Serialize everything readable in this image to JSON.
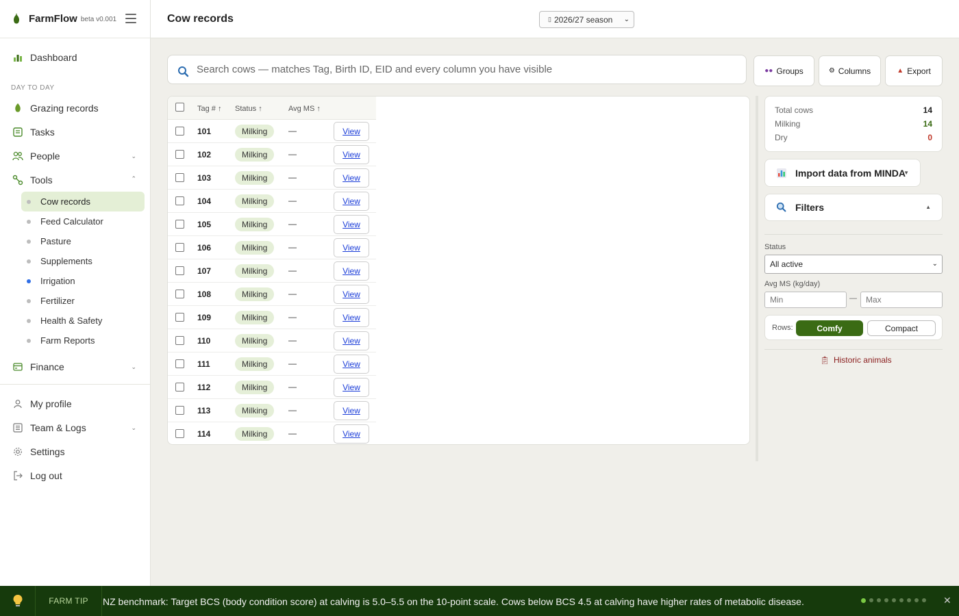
{
  "app": {
    "name": "FarmFlow",
    "version": "beta v0.001"
  },
  "sidebar": {
    "dashboard": "Dashboard",
    "section_day_to_day": "DAY TO DAY",
    "grazing": "Grazing records",
    "tasks": "Tasks",
    "people": "People",
    "tools": "Tools",
    "tools_items": [
      "Cow records",
      "Feed Calculator",
      "Pasture",
      "Supplements",
      "Irrigation",
      "Fertilizer",
      "Health & Safety",
      "Farm Reports"
    ],
    "finance": "Finance",
    "my_profile": "My profile",
    "team_logs": "Team & Logs",
    "settings": "Settings",
    "log_out": "Log out"
  },
  "header": {
    "title": "Cow records",
    "season": "2026/27 season"
  },
  "search": {
    "placeholder": "Search cows — matches Tag, Birth ID, EID and every column you have visible"
  },
  "toolbar": {
    "groups": "Groups",
    "columns": "Columns",
    "export": "Export"
  },
  "table": {
    "headers": {
      "tag": "Tag # ↑",
      "status": "Status ↑",
      "avg": "Avg MS ↑"
    },
    "view_label": "View",
    "rows": [
      {
        "tag": "101",
        "status": "Milking",
        "avg": "—"
      },
      {
        "tag": "102",
        "status": "Milking",
        "avg": "—"
      },
      {
        "tag": "103",
        "status": "Milking",
        "avg": "—"
      },
      {
        "tag": "104",
        "status": "Milking",
        "avg": "—"
      },
      {
        "tag": "105",
        "status": "Milking",
        "avg": "—"
      },
      {
        "tag": "106",
        "status": "Milking",
        "avg": "—"
      },
      {
        "tag": "107",
        "status": "Milking",
        "avg": "—"
      },
      {
        "tag": "108",
        "status": "Milking",
        "avg": "—"
      },
      {
        "tag": "109",
        "status": "Milking",
        "avg": "—"
      },
      {
        "tag": "110",
        "status": "Milking",
        "avg": "—"
      },
      {
        "tag": "111",
        "status": "Milking",
        "avg": "—"
      },
      {
        "tag": "112",
        "status": "Milking",
        "avg": "—"
      },
      {
        "tag": "113",
        "status": "Milking",
        "avg": "—"
      },
      {
        "tag": "114",
        "status": "Milking",
        "avg": "—"
      }
    ]
  },
  "stats": {
    "total_label": "Total cows",
    "total": "14",
    "milking_label": "Milking",
    "milking": "14",
    "dry_label": "Dry",
    "dry": "0"
  },
  "import_label": "Import data from MINDA",
  "filters": {
    "title": "Filters",
    "status_label": "Status",
    "status_value": "All active",
    "avg_label": "Avg MS (kg/day)",
    "min_placeholder": "Min",
    "max_placeholder": "Max",
    "dash": "—",
    "rows_label": "Rows:",
    "comfy": "Comfy",
    "compact": "Compact",
    "historic": "Historic animals"
  },
  "tip": {
    "label": "FARM TIP",
    "text": "NZ benchmark: Target BCS (body condition score) at calving is 5.0–5.5 on the 10-point scale. Cows below BCS 4.5 at calving have higher rates of metabolic disease.",
    "close": "✕"
  },
  "colors": {
    "brand_green": "#3a6b14",
    "tip_bg": "#163a0c",
    "milking_badge": "#e5efd8",
    "dry_red": "#c0392b"
  }
}
